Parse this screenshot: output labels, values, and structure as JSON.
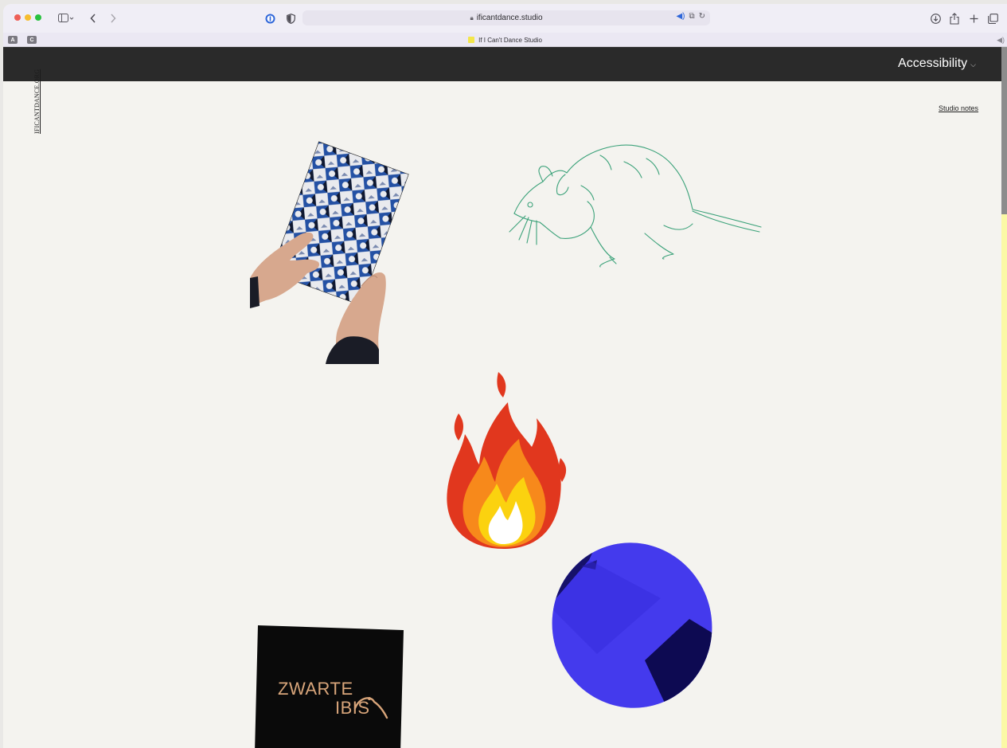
{
  "browser": {
    "url": "ificantdance.studio",
    "tab_title": "If I Can't Dance Studio",
    "pills": [
      "A",
      "C"
    ]
  },
  "header": {
    "accessibility_label": "Accessibility"
  },
  "side_link": "IFICANTDANCE.ORG",
  "studio_notes": "Studio notes",
  "collage": {
    "logo_line1": "ZWARTE",
    "logo_line2": "IBIS"
  },
  "icons": {
    "sidebar": "sidebar-icon",
    "back": "back-icon",
    "forward": "forward-icon",
    "password": "password-icon",
    "privacy": "shield-icon",
    "download": "download-icon",
    "share": "share-icon",
    "new_tab": "plus-icon",
    "tabs": "tabs-overview-icon"
  },
  "colors": {
    "header_bg": "#2a2a2a",
    "page_bg": "#f4f3ef",
    "scroll_track": "#fbf9a6",
    "rat_line": "#3ca27a",
    "blue_disc": "#3b31e8"
  }
}
